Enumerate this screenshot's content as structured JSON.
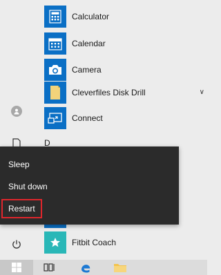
{
  "apps": [
    {
      "label": "Calculator",
      "icon": "calculator-icon"
    },
    {
      "label": "Calendar",
      "icon": "calendar-icon"
    },
    {
      "label": "Camera",
      "icon": "camera-icon"
    },
    {
      "label": "Cleverfiles Disk Drill",
      "icon": "folder-icon",
      "expandable": true
    },
    {
      "label": "Connect",
      "icon": "connect-icon"
    },
    {
      "label": "Fitbit Coach",
      "icon": "star-icon",
      "icon_color": "#29b7b7"
    }
  ],
  "group_letter": "D",
  "power_menu": {
    "items": [
      {
        "label": "Sleep"
      },
      {
        "label": "Shut down"
      },
      {
        "label": "Restart",
        "highlighted": true
      }
    ],
    "highlight_color": "#e0262c"
  },
  "colors": {
    "tile_blue": "#0a6fc5",
    "menu_bg": "#ececec",
    "popup_bg": "#2b2b2b",
    "taskbar_bg": "#dcdcdc"
  },
  "taskbar": [
    "windows-start-icon",
    "task-view-icon",
    "edge-icon",
    "file-explorer-icon"
  ]
}
